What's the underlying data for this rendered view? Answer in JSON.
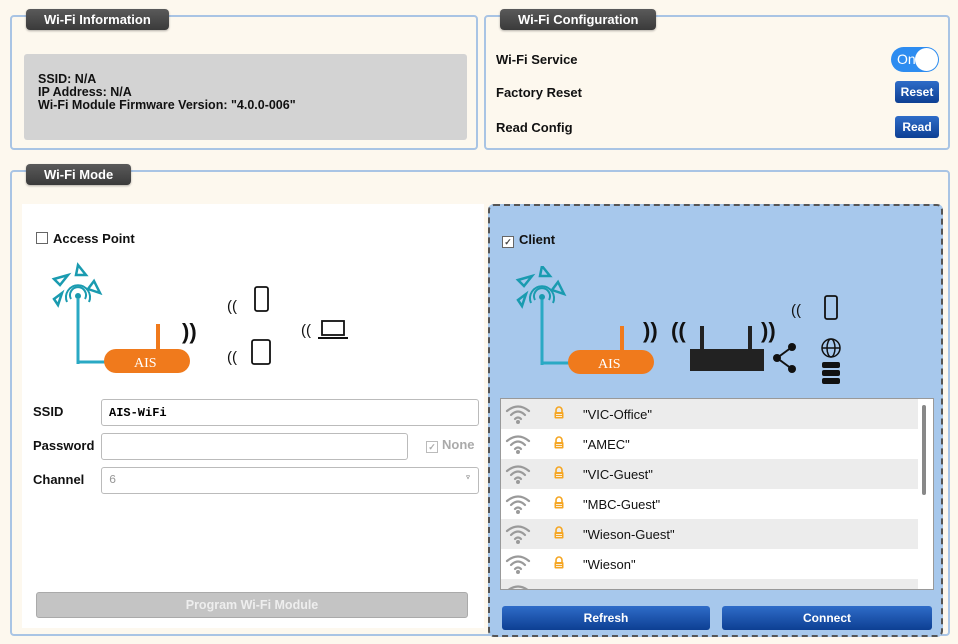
{
  "wifi_info": {
    "legend": "Wi-Fi Information",
    "ssid_line": "SSID: N/A",
    "ip_line": "IP Address: N/A",
    "firmware_line": "Wi-Fi Module Firmware Version: \"4.0.0-006\""
  },
  "wifi_config": {
    "legend": "Wi-Fi Configuration",
    "service_label": "Wi-Fi Service",
    "service_toggle": "On",
    "factory_reset_label": "Factory Reset",
    "reset_button": "Reset",
    "read_config_label": "Read Config",
    "read_button": "Read"
  },
  "wifi_mode": {
    "legend": "Wi-Fi Mode",
    "access_point": {
      "label": "Access Point",
      "checked": false,
      "brand": "AIS",
      "ssid_label": "SSID",
      "ssid_value": "AIS-WiFi",
      "password_label": "Password",
      "password_value": "",
      "none_label": "None",
      "channel_label": "Channel",
      "channel_value": "6",
      "program_button": "Program Wi-Fi Module"
    },
    "client": {
      "label": "Client",
      "checked": true,
      "brand": "AIS",
      "networks": [
        "\"VIC-Office\"",
        "\"AMEC\"",
        "\"VIC-Guest\"",
        "\"MBC-Guest\"",
        "\"Wieson-Guest\"",
        "\"Wieson\""
      ],
      "refresh_button": "Refresh",
      "connect_button": "Connect"
    }
  },
  "colors": {
    "accent_blue": "#0d3f93",
    "router_orange": "#f07a1c",
    "client_panel_bg": "#a7c8ec",
    "lock_orange": "#f5a623"
  }
}
